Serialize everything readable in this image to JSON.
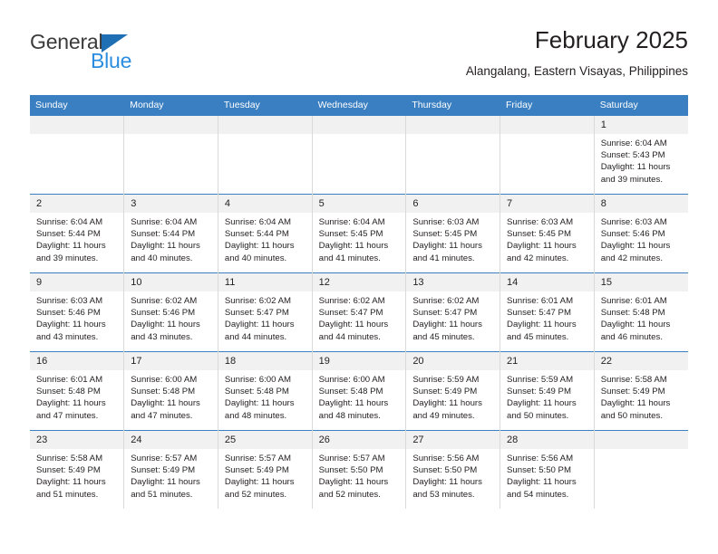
{
  "brand": {
    "name_primary": "General",
    "name_secondary": "Blue",
    "primary_color": "#3b3b3b",
    "secondary_color": "#2b8ddf",
    "triangle_color": "#1f6fb5"
  },
  "header": {
    "title": "February 2025",
    "subtitle": "Alangalang, Eastern Visayas, Philippines"
  },
  "theme": {
    "header_row_bg": "#3a7fc1",
    "header_row_text": "#ffffff",
    "day_number_bg": "#f1f1f1",
    "grid_line": "#d9d9d9",
    "week_divider": "#3a7fc1",
    "body_text": "#231f20"
  },
  "weekday_headers": [
    "Sunday",
    "Monday",
    "Tuesday",
    "Wednesday",
    "Thursday",
    "Friday",
    "Saturday"
  ],
  "weeks": [
    [
      {
        "day": "",
        "sunrise": "",
        "sunset": "",
        "daylight": "",
        "blank": true
      },
      {
        "day": "",
        "sunrise": "",
        "sunset": "",
        "daylight": "",
        "blank": true
      },
      {
        "day": "",
        "sunrise": "",
        "sunset": "",
        "daylight": "",
        "blank": true
      },
      {
        "day": "",
        "sunrise": "",
        "sunset": "",
        "daylight": "",
        "blank": true
      },
      {
        "day": "",
        "sunrise": "",
        "sunset": "",
        "daylight": "",
        "blank": true
      },
      {
        "day": "",
        "sunrise": "",
        "sunset": "",
        "daylight": "",
        "blank": true
      },
      {
        "day": "1",
        "sunrise": "Sunrise: 6:04 AM",
        "sunset": "Sunset: 5:43 PM",
        "daylight": "Daylight: 11 hours and 39 minutes.",
        "blank": false
      }
    ],
    [
      {
        "day": "2",
        "sunrise": "Sunrise: 6:04 AM",
        "sunset": "Sunset: 5:44 PM",
        "daylight": "Daylight: 11 hours and 39 minutes.",
        "blank": false
      },
      {
        "day": "3",
        "sunrise": "Sunrise: 6:04 AM",
        "sunset": "Sunset: 5:44 PM",
        "daylight": "Daylight: 11 hours and 40 minutes.",
        "blank": false
      },
      {
        "day": "4",
        "sunrise": "Sunrise: 6:04 AM",
        "sunset": "Sunset: 5:44 PM",
        "daylight": "Daylight: 11 hours and 40 minutes.",
        "blank": false
      },
      {
        "day": "5",
        "sunrise": "Sunrise: 6:04 AM",
        "sunset": "Sunset: 5:45 PM",
        "daylight": "Daylight: 11 hours and 41 minutes.",
        "blank": false
      },
      {
        "day": "6",
        "sunrise": "Sunrise: 6:03 AM",
        "sunset": "Sunset: 5:45 PM",
        "daylight": "Daylight: 11 hours and 41 minutes.",
        "blank": false
      },
      {
        "day": "7",
        "sunrise": "Sunrise: 6:03 AM",
        "sunset": "Sunset: 5:45 PM",
        "daylight": "Daylight: 11 hours and 42 minutes.",
        "blank": false
      },
      {
        "day": "8",
        "sunrise": "Sunrise: 6:03 AM",
        "sunset": "Sunset: 5:46 PM",
        "daylight": "Daylight: 11 hours and 42 minutes.",
        "blank": false
      }
    ],
    [
      {
        "day": "9",
        "sunrise": "Sunrise: 6:03 AM",
        "sunset": "Sunset: 5:46 PM",
        "daylight": "Daylight: 11 hours and 43 minutes.",
        "blank": false
      },
      {
        "day": "10",
        "sunrise": "Sunrise: 6:02 AM",
        "sunset": "Sunset: 5:46 PM",
        "daylight": "Daylight: 11 hours and 43 minutes.",
        "blank": false
      },
      {
        "day": "11",
        "sunrise": "Sunrise: 6:02 AM",
        "sunset": "Sunset: 5:47 PM",
        "daylight": "Daylight: 11 hours and 44 minutes.",
        "blank": false
      },
      {
        "day": "12",
        "sunrise": "Sunrise: 6:02 AM",
        "sunset": "Sunset: 5:47 PM",
        "daylight": "Daylight: 11 hours and 44 minutes.",
        "blank": false
      },
      {
        "day": "13",
        "sunrise": "Sunrise: 6:02 AM",
        "sunset": "Sunset: 5:47 PM",
        "daylight": "Daylight: 11 hours and 45 minutes.",
        "blank": false
      },
      {
        "day": "14",
        "sunrise": "Sunrise: 6:01 AM",
        "sunset": "Sunset: 5:47 PM",
        "daylight": "Daylight: 11 hours and 45 minutes.",
        "blank": false
      },
      {
        "day": "15",
        "sunrise": "Sunrise: 6:01 AM",
        "sunset": "Sunset: 5:48 PM",
        "daylight": "Daylight: 11 hours and 46 minutes.",
        "blank": false
      }
    ],
    [
      {
        "day": "16",
        "sunrise": "Sunrise: 6:01 AM",
        "sunset": "Sunset: 5:48 PM",
        "daylight": "Daylight: 11 hours and 47 minutes.",
        "blank": false
      },
      {
        "day": "17",
        "sunrise": "Sunrise: 6:00 AM",
        "sunset": "Sunset: 5:48 PM",
        "daylight": "Daylight: 11 hours and 47 minutes.",
        "blank": false
      },
      {
        "day": "18",
        "sunrise": "Sunrise: 6:00 AM",
        "sunset": "Sunset: 5:48 PM",
        "daylight": "Daylight: 11 hours and 48 minutes.",
        "blank": false
      },
      {
        "day": "19",
        "sunrise": "Sunrise: 6:00 AM",
        "sunset": "Sunset: 5:48 PM",
        "daylight": "Daylight: 11 hours and 48 minutes.",
        "blank": false
      },
      {
        "day": "20",
        "sunrise": "Sunrise: 5:59 AM",
        "sunset": "Sunset: 5:49 PM",
        "daylight": "Daylight: 11 hours and 49 minutes.",
        "blank": false
      },
      {
        "day": "21",
        "sunrise": "Sunrise: 5:59 AM",
        "sunset": "Sunset: 5:49 PM",
        "daylight": "Daylight: 11 hours and 50 minutes.",
        "blank": false
      },
      {
        "day": "22",
        "sunrise": "Sunrise: 5:58 AM",
        "sunset": "Sunset: 5:49 PM",
        "daylight": "Daylight: 11 hours and 50 minutes.",
        "blank": false
      }
    ],
    [
      {
        "day": "23",
        "sunrise": "Sunrise: 5:58 AM",
        "sunset": "Sunset: 5:49 PM",
        "daylight": "Daylight: 11 hours and 51 minutes.",
        "blank": false
      },
      {
        "day": "24",
        "sunrise": "Sunrise: 5:57 AM",
        "sunset": "Sunset: 5:49 PM",
        "daylight": "Daylight: 11 hours and 51 minutes.",
        "blank": false
      },
      {
        "day": "25",
        "sunrise": "Sunrise: 5:57 AM",
        "sunset": "Sunset: 5:49 PM",
        "daylight": "Daylight: 11 hours and 52 minutes.",
        "blank": false
      },
      {
        "day": "26",
        "sunrise": "Sunrise: 5:57 AM",
        "sunset": "Sunset: 5:50 PM",
        "daylight": "Daylight: 11 hours and 52 minutes.",
        "blank": false
      },
      {
        "day": "27",
        "sunrise": "Sunrise: 5:56 AM",
        "sunset": "Sunset: 5:50 PM",
        "daylight": "Daylight: 11 hours and 53 minutes.",
        "blank": false
      },
      {
        "day": "28",
        "sunrise": "Sunrise: 5:56 AM",
        "sunset": "Sunset: 5:50 PM",
        "daylight": "Daylight: 11 hours and 54 minutes.",
        "blank": false
      },
      {
        "day": "",
        "sunrise": "",
        "sunset": "",
        "daylight": "",
        "blank": true
      }
    ]
  ]
}
